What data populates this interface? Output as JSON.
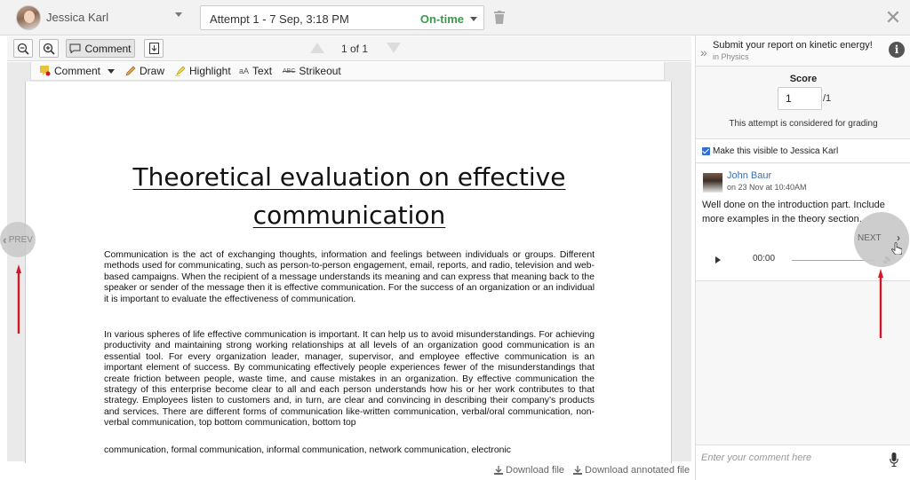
{
  "header": {
    "student_name": "Jessica Karl",
    "attempt_label": "Attempt 1 - 7 Sep, 3:18 PM",
    "attempt_status": "On-time",
    "close_glyph": "✕"
  },
  "toolbar": {
    "comment_label": "Comment",
    "page_indicator": "1 of 1"
  },
  "annotations": {
    "comment": "Comment",
    "draw": "Draw",
    "highlight": "Highlight",
    "text": "Text",
    "strikeout": "Strikeout",
    "text_icon_glyph": "aA",
    "strike_icon_glyph": "ABC"
  },
  "document": {
    "title_line1": "Theoretical evaluation on effective",
    "title_line2": "communication",
    "paragraphs": [
      "Communication is the act of exchanging thoughts, information and feelings between individuals or groups. Different methods used for communicating, such as person-to-person engagement, email, reports, and radio, television and web-based campaigns. When the recipient of a message understands its meaning and can express that meaning back to the speaker or sender of the message then it is effective communication. For the success of an organization or an individual it is important to evaluate the effectiveness of communication.",
      "In various spheres of life effective communication is important. It can help us to avoid misunderstandings. For achieving productivity and maintaining strong working relationships at all levels of an organization good communication is an essential tool. For every organization leader, manager, supervisor, and employee effective communication is an important element of success. By communicating effectively people experiences fewer of the misunderstandings that create friction between people, waste time, and cause mistakes in an organization. By effective communication the strategy of this enterprise become clear to all and each person understands how his or her work contributes to that strategy. Employees listen to customers and, in turn, are clear and convincing in describing their company’s products and services. There are different forms of communication like-written communication, verbal/oral communication, non-verbal communication, top bottom communication, bottom top",
      "communication, formal communication, informal communication, network communication, electronic"
    ]
  },
  "nav": {
    "prev_label": "PREV",
    "next_label": "NEXT",
    "prev_chevron": "‹",
    "next_chevron": "›"
  },
  "downloads": {
    "download_file": "Download file",
    "download_annotated": "Download annotated file"
  },
  "assignment": {
    "title": "Submit your report on kinetic energy!",
    "subject": "in Physics",
    "info_glyph": "i",
    "expand_glyph": "»"
  },
  "grading": {
    "score_label": "Score",
    "score_value": "1",
    "score_max": "/1",
    "note": "This attempt is considered for grading",
    "visible_label": "Make this visible to Jessica Karl"
  },
  "comment": {
    "author": "John Baur",
    "date": "on 23 Nov at 10:40AM",
    "text": "Well done on the introduction part. Include more examples in the theory section.",
    "audio_time": "00:00",
    "volume_glyph": "🔊"
  },
  "composer": {
    "placeholder": "Enter your comment here"
  },
  "colors": {
    "on_time": "#3a9a4b",
    "accent_red": "#d0182a",
    "link_blue": "#3b6fb6"
  }
}
